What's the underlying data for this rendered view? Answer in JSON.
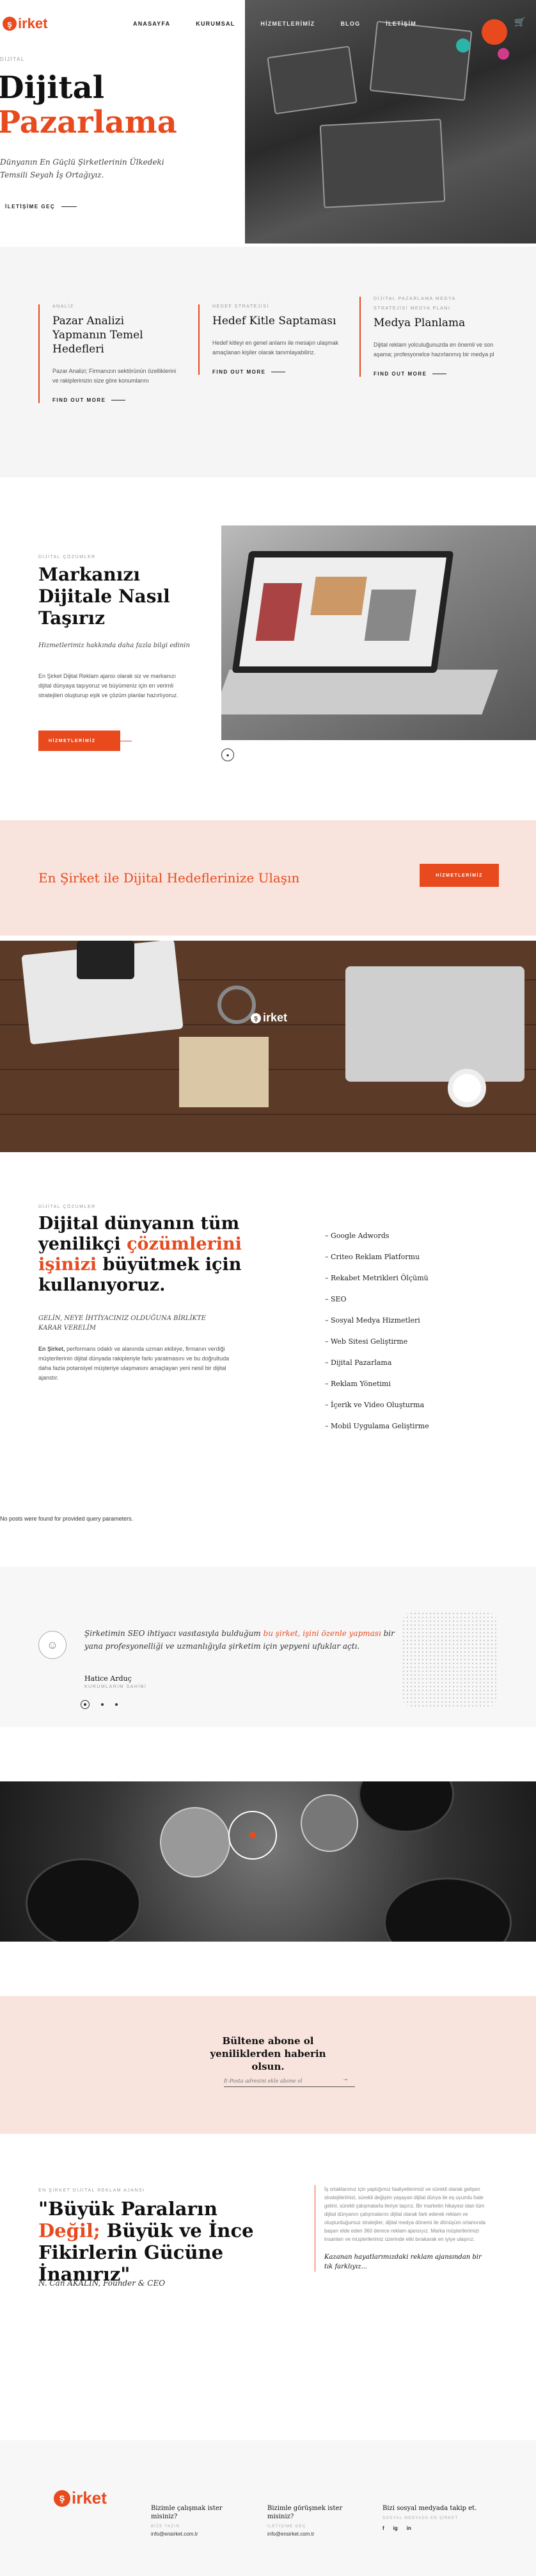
{
  "header": {
    "logo_mark": "ş",
    "logo_word": "irket",
    "nav": [
      "ANASAYFA",
      "KURUMSAL",
      "HİZMETLERİMİZ",
      "BLOG",
      "İLETİŞİM"
    ],
    "cart_icon": "cart-icon"
  },
  "hero": {
    "small": "DİJİTAL",
    "title_line1": "Dijital",
    "title_line2": "Pazarlama",
    "subtitle": "Dünyanın En Güçlü Şirketlerinin Ülkedeki Temsili Seyah İş Ortağıyız.",
    "button": "İLETİŞİME GEÇ"
  },
  "services": [
    {
      "tag": "ANALİZ",
      "title": "Pazar Analizi Yapmanın Temel Hedefleri",
      "text": "Pazar Analizi; Firmanızın sektörünün özelliklerini ve rakiplerinizin size göre konumlarını",
      "more": "FIND OUT MORE"
    },
    {
      "tag": "HEDEF STRATEJİSİ",
      "title": "Hedef Kitle Saptaması",
      "text": "Hedef kitleyi en genel anlamı ile mesajın ulaşmak amaçlanan kişiler olarak tanımlayabiliriz.",
      "more": "FIND OUT MORE"
    },
    {
      "tag": "DİJİTAL PAZARLAMA MEDYA",
      "tag2": "STRATEJİSİ MEDYA PLANI",
      "title": "Medya Planlama",
      "text": "Dijital reklam yolculuğunuzda en önemli ve son aşama; profesyonelce hazırlanmış bir medya pl",
      "more": "FIND OUT MORE"
    }
  ],
  "brand": {
    "small": "DİJİTAL ÇÖZÜMLER",
    "title": "Markanızı Dijitale Nasıl Taşırız",
    "subtitle": "Hizmetlerimiz hakkında daha fazla bilgi edinin",
    "text": "En Şirket Dijital Reklam ajansı olarak siz ve markanızı dijital dünyaya taşıyoruz ve büyümeniz için en verimli stratejileri oluşturup eşik ve çözüm planlar hazırlıyoruz.",
    "button": "HİZMETLERİMİZ"
  },
  "cta": {
    "text": "En Şirket ile Dijital Hedeflerinize Ulaşın",
    "button": "HİZMETLERİMİZ"
  },
  "desk": {
    "logo_mark": "ş",
    "logo_word": "irket"
  },
  "digital": {
    "small": "DİJİTAL ÇÖZÜMLER",
    "title_pre": "Dijital dünyanın tüm yenilikçi ",
    "title_accent": "çözümlerini işinizi",
    "title_post": " büyütmek için kullanıyoruz.",
    "caps": "GELİN, NEYE İHTİYACINIZ OLDUĞUNA BİRLİKTE KARAR VERELİM",
    "text_bold": "En Şirket,",
    "text": " performans odaklı ve alanında uzman ekibiye, firmanın verdiği müşterilerinin dijital dünyada rakipleriyle farkı yaratmasını ve bu doğrultuda daha fazla potansiyel müşteriye ulaşmasını amaçlayan yeni nesil bir dijital ajanstır.",
    "list": [
      "– Google Adwords",
      "– Criteo Reklam Platformu",
      "– Rekabet Metrikleri Ölçümü",
      "– SEO",
      "– Sosyal Medya Hizmetleri",
      "– Web Sitesi Geliştirme",
      "– Dijital Pazarlama",
      "– Reklam Yönetimi",
      "– İçerik ve Video Oluşturma",
      "– Mobil Uygulama Geliştirme"
    ]
  },
  "no_posts": "No posts were found for provided query parameters.",
  "testimonial": {
    "quote_pre": "Şirketimin SEO ihtiyacı vasıtasıyla bulduğum ",
    "quote_accent": "bu şirket, işini özenle yapması",
    "quote_post": " bir yana profesyonelliği ve uzmanlığıyla şirketim için yepyeni ufuklar açtı.",
    "name": "Hatice Arduç",
    "role": "KURUMLARIM SAHİBİ"
  },
  "newsletter": {
    "title": "Bültene abone ol yeniliklerden haberin olsun.",
    "placeholder": "E-Posta adresini ekle abone ol",
    "submit": "→"
  },
  "quote": {
    "small": "EN ŞİRKET DİJİTAL REKLAM AJANSI",
    "title_pre": "\"Büyük Paraların ",
    "title_accent": "Değil;",
    "title_post": " Büyük ve İnce Fikirlerin Gücüne İnanırız\"",
    "author": "N. Can AKALIN, Founder & CEO",
    "text": "İş ortaklarımız için yaptığımız faaliyetlerimizi ve sürekli olarak gelişen stratejilerimizi, sürekli değişim yaşayan dijital dünya ile eş uyumlu hale getirir, sürekli çalışmalarla ileriye taşırız. Bir marketin hikayesi olan tüm dijital dünyanın çalışmalarını dijital olarak fark ederek reklam ve oluşturduğumuz stratejiler, dijital medya dönemi ile dönüşüm ortamında başarı elde eden 360 derece reklam ajansıyız. Marka müşterilerimizi insanları ve müşterilerimiz üzerinde etki bırakarak en iyiye ulaşırız.",
    "em": "Kazanan hayatlarımızdaki reklam ajansından bir tık farklıyız..."
  },
  "footer": {
    "logo_mark": "ş",
    "logo_word": "irket",
    "col1": {
      "h": "Bizimle çalışmak ister misiniz?",
      "s": "BİZE YAZIN",
      "m": "info@ensirket.com.tr"
    },
    "col2": {
      "h": "Bizimle görüşmek ister misiniz?",
      "s": "İLETİŞİME GEÇ",
      "m": "info@ensirket.com.tr"
    },
    "col3": {
      "h": "Bizi sosyal medyada takip et.",
      "s": "SOSYAL MEDYADA EN ŞİRKET"
    },
    "social": [
      "f",
      "ig",
      "in"
    ]
  },
  "colors": {
    "accent": "#e84a1e",
    "peach": "#f8e4dc",
    "light": "#f5f5f5"
  }
}
